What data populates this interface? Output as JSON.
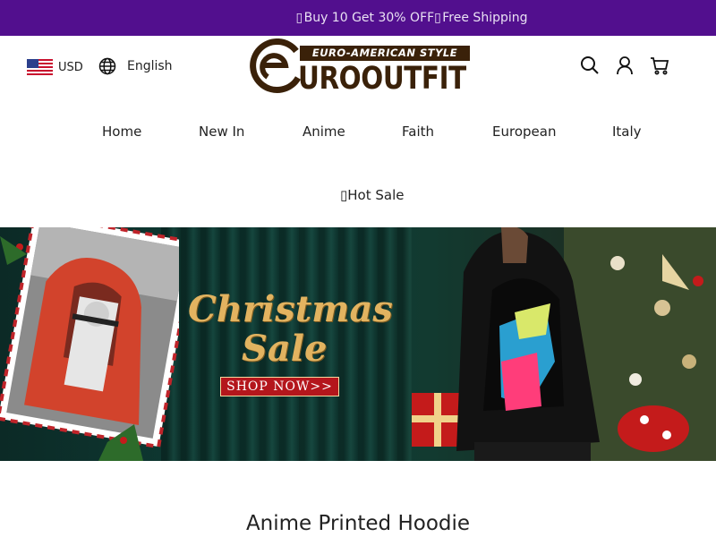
{
  "promo": {
    "text": "▯ Buy 10 Get 30% OFF▯ Free Shipping"
  },
  "header": {
    "currency": "USD",
    "language": "English",
    "logo": {
      "tagline": "EURO-AMERICAN STYLE",
      "wordmark": "UROOUTFIT",
      "letter": "e"
    },
    "icons": [
      "search-icon",
      "account-icon",
      "cart-icon"
    ]
  },
  "nav": {
    "items": [
      {
        "label": "Home"
      },
      {
        "label": "New In"
      },
      {
        "label": "Anime"
      },
      {
        "label": "Faith"
      },
      {
        "label": "European"
      },
      {
        "label": "Italy"
      },
      {
        "label": "▯Hot Sale"
      }
    ]
  },
  "banner": {
    "title_line1": "Christmas",
    "title_line2": "Sale",
    "cta": "SHOP NOW>>"
  },
  "section": {
    "title": "Anime Printed Hoodie"
  },
  "colors": {
    "promo_bg": "#520f8e",
    "logo_brown": "#3a2109",
    "gold": "#e2b360",
    "cta_red": "#b4161c"
  }
}
